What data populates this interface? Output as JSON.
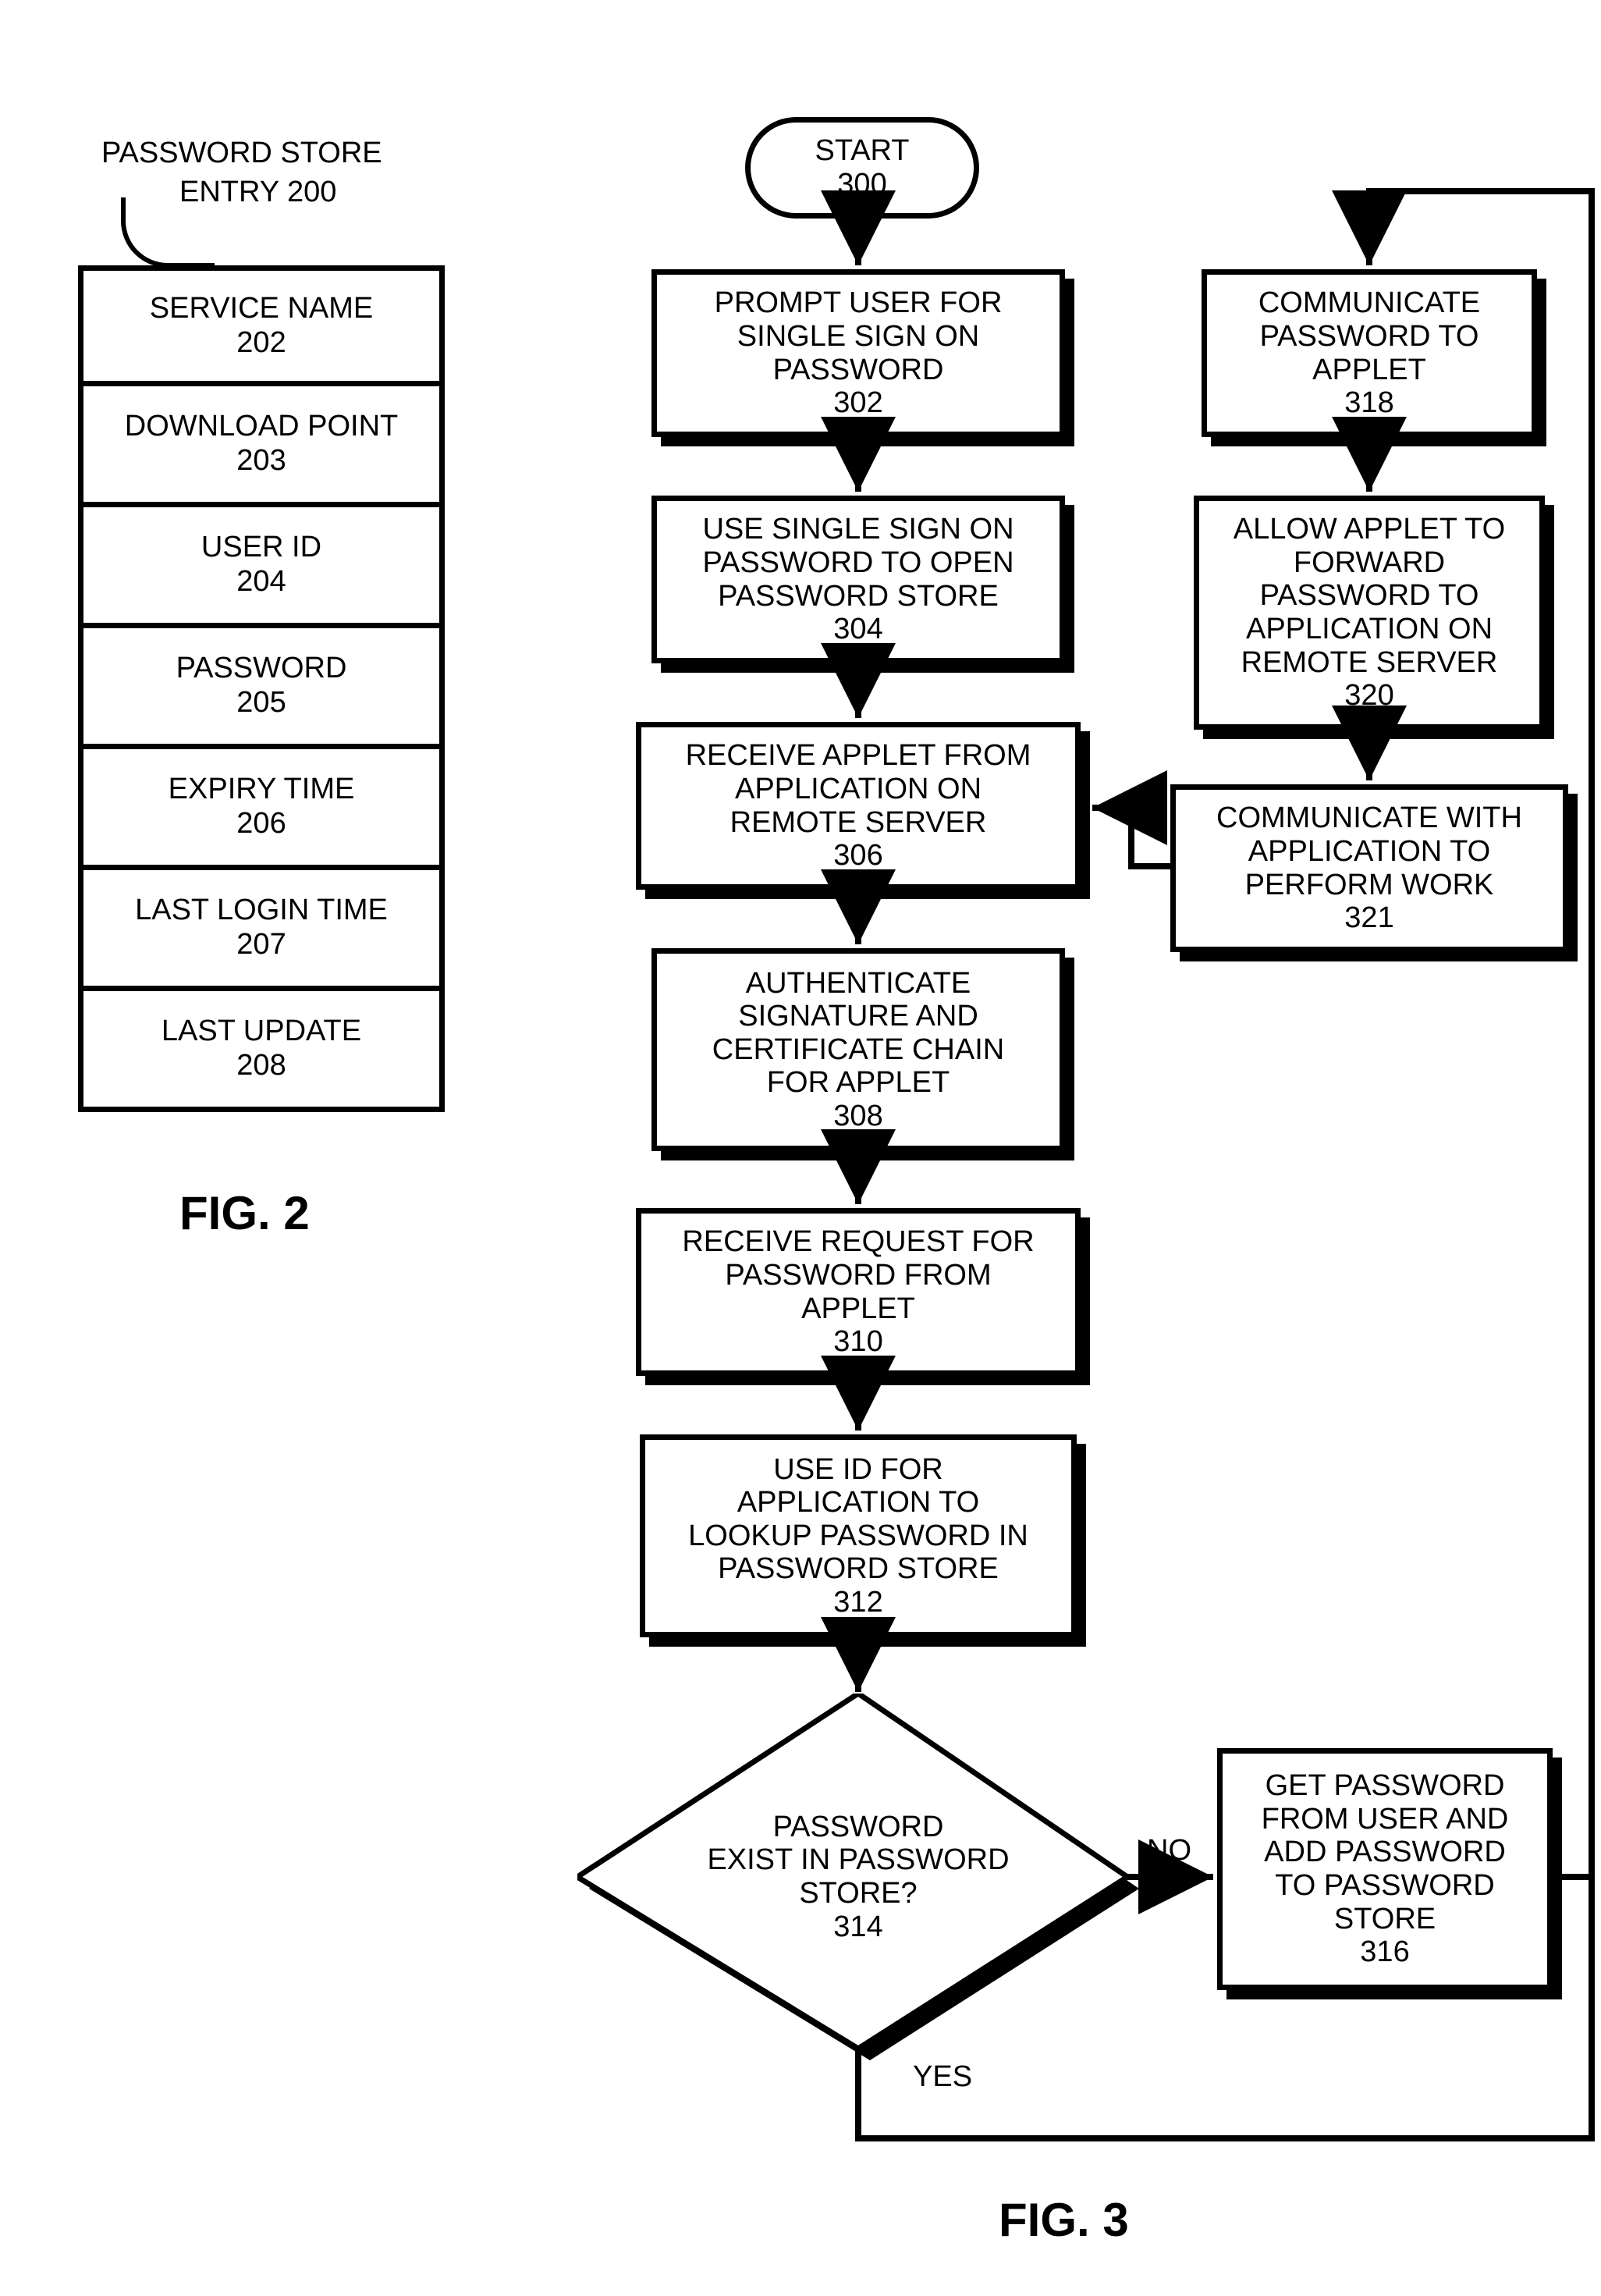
{
  "fig2": {
    "header_l1": "PASSWORD STORE",
    "header_l2": "ENTRY 200",
    "rows": [
      {
        "label": "SERVICE NAME",
        "ref": "202"
      },
      {
        "label": "DOWNLOAD POINT",
        "ref": "203"
      },
      {
        "label": "USER ID",
        "ref": "204"
      },
      {
        "label": "PASSWORD",
        "ref": "205"
      },
      {
        "label": "EXPIRY TIME",
        "ref": "206"
      },
      {
        "label": "LAST LOGIN TIME",
        "ref": "207"
      },
      {
        "label": "LAST UPDATE",
        "ref": "208"
      }
    ],
    "caption": "FIG. 2"
  },
  "fig3": {
    "start": {
      "label": "START",
      "ref": "300"
    },
    "n302": {
      "l1": "PROMPT USER FOR",
      "l2": "SINGLE SIGN ON",
      "l3": "PASSWORD",
      "ref": "302"
    },
    "n304": {
      "l1": "USE SINGLE SIGN ON",
      "l2": "PASSWORD TO OPEN",
      "l3": "PASSWORD STORE",
      "ref": "304"
    },
    "n306": {
      "l1": "RECEIVE APPLET FROM",
      "l2": "APPLICATION ON",
      "l3": "REMOTE SERVER",
      "ref": "306"
    },
    "n308": {
      "l1": "AUTHENTICATE",
      "l2": "SIGNATURE AND",
      "l3": "CERTIFICATE CHAIN",
      "l4": "FOR APPLET",
      "ref": "308"
    },
    "n310": {
      "l1": "RECEIVE REQUEST FOR",
      "l2": "PASSWORD FROM",
      "l3": "APPLET",
      "ref": "310"
    },
    "n312": {
      "l1": "USE ID FOR",
      "l2": "APPLICATION TO",
      "l3": "LOOKUP PASSWORD IN",
      "l4": "PASSWORD STORE",
      "ref": "312"
    },
    "d314": {
      "l1": "PASSWORD",
      "l2": "EXIST IN PASSWORD",
      "l3": "STORE?",
      "ref": "314"
    },
    "n316": {
      "l1": "GET PASSWORD",
      "l2": "FROM USER AND",
      "l3": "ADD PASSWORD",
      "l4": "TO PASSWORD",
      "l5": "STORE",
      "ref": "316"
    },
    "n318": {
      "l1": "COMMUNICATE",
      "l2": "PASSWORD TO",
      "l3": "APPLET",
      "ref": "318"
    },
    "n320": {
      "l1": "ALLOW APPLET TO",
      "l2": "FORWARD",
      "l3": "PASSWORD TO",
      "l4": "APPLICATION ON",
      "l5": "REMOTE SERVER",
      "ref": "320"
    },
    "n321": {
      "l1": "COMMUNICATE WITH",
      "l2": "APPLICATION TO",
      "l3": "PERFORM WORK",
      "ref": "321"
    },
    "no_label": "NO",
    "yes_label": "YES",
    "caption": "FIG. 3"
  }
}
